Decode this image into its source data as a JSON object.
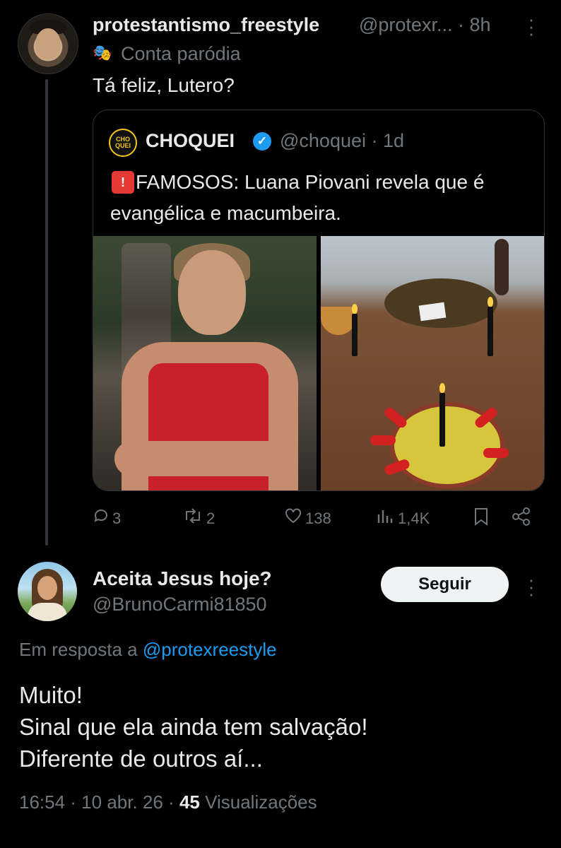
{
  "quoting_tweet": {
    "author_name": "protestantismo_freestyle",
    "author_handle": "@protexr...",
    "time": "· 8h",
    "parody_label": "Conta paródia",
    "text": "Tá feliz, Lutero?"
  },
  "quoted_tweet": {
    "avatar_text": "CHO QUEI",
    "author_name": "CHOQUEI",
    "author_handle": "@choquei",
    "time": "· 1d",
    "text": "FAMOSOS: Luana Piovani revela que é evangélica e macumbeira.",
    "images": [
      "woman-in-red-dress-photo",
      "ritual-offering-photo"
    ]
  },
  "actions": {
    "replies": "3",
    "reposts": "2",
    "likes": "138",
    "views": "1,4K"
  },
  "reply": {
    "author_name": "Aceita Jesus hoje?",
    "author_handle": "@BrunoCarmi81850",
    "follow_label": "Seguir",
    "replying_prefix": "Em resposta a",
    "replying_to": "@protexreestyle",
    "lines": [
      "Muito!",
      "Sinal que ela ainda tem salvação!",
      "Diferente de outros aí..."
    ],
    "time": "16:54 · 10 abr. 26 ·",
    "views_count": "45",
    "views_label": "Visualizações"
  },
  "colors": {
    "background": "#000000",
    "text": "#e7e9ea",
    "muted": "#71767b",
    "link": "#1d9bf0",
    "verified": "#1d9bf0",
    "follow_bg": "#eff3f4"
  }
}
